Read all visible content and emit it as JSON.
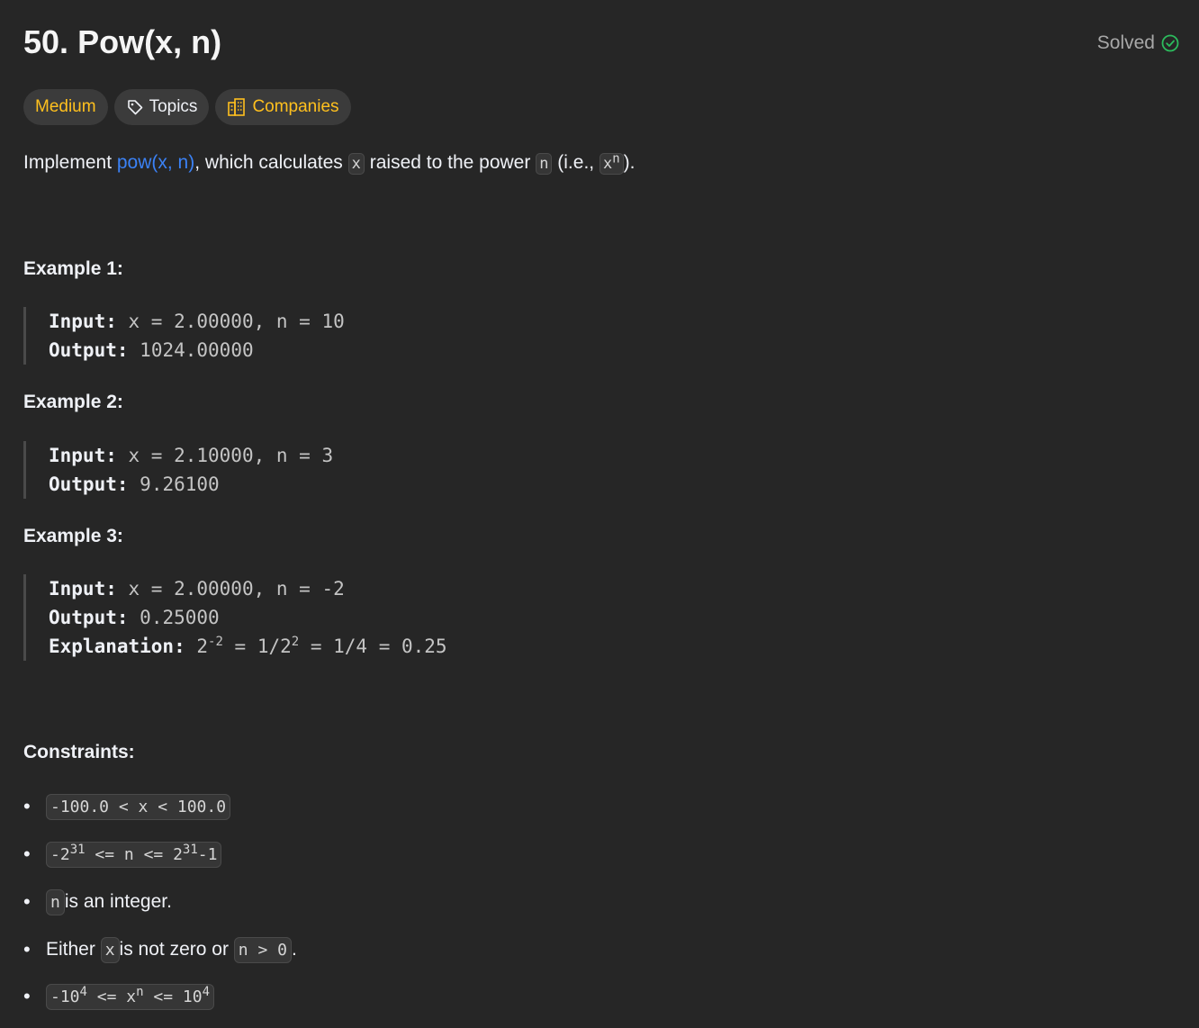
{
  "problem": {
    "number": "50.",
    "name": "Pow(x, n)",
    "status": "Solved"
  },
  "tags": {
    "difficulty": "Medium",
    "topics": "Topics",
    "companies": "Companies"
  },
  "description": {
    "prefix": "Implement ",
    "link": "pow(x, n)",
    "middle": ", which calculates ",
    "x": "x",
    "middle2": " raised to the power ",
    "n": "n",
    "middle3": " (i.e., ",
    "xn_base": "x",
    "xn_exp": "n",
    "suffix": ")."
  },
  "examples": [
    {
      "heading": "Example 1:",
      "input_label": "Input:",
      "input": "x = 2.00000, n = 10",
      "output_label": "Output:",
      "output": "1024.00000"
    },
    {
      "heading": "Example 2:",
      "input_label": "Input:",
      "input": "x = 2.10000, n = 3",
      "output_label": "Output:",
      "output": "9.26100"
    },
    {
      "heading": "Example 3:",
      "input_label": "Input:",
      "input": "x = 2.00000, n = -2",
      "output_label": "Output:",
      "output": "0.25000",
      "explanation_label": "Explanation:",
      "exp_base1": "2",
      "exp_pow1": "-2",
      "exp_mid": " = 1/2",
      "exp_pow2": "2",
      "exp_end": " = 1/4 = 0.25"
    }
  ],
  "constraints": {
    "heading": "Constraints:",
    "c1": "-100.0 < x < 100.0",
    "c2_a": "-2",
    "c2_a_exp": "31",
    "c2_b": " <= n <= 2",
    "c2_b_exp": "31",
    "c2_c": "-1",
    "c3_code": "n",
    "c3_text": " is an integer.",
    "c4_pre": "Either ",
    "c4_code1": "x",
    "c4_mid": " is not zero or ",
    "c4_code2": "n > 0",
    "c4_end": ".",
    "c5_a": "-10",
    "c5_a_exp": "4",
    "c5_b": " <= x",
    "c5_b_exp": "n",
    "c5_c": " <= 10",
    "c5_c_exp": "4"
  },
  "colors": {
    "background": "#262626",
    "medium": "#ffc01e",
    "link": "#3b82f6",
    "solved_check": "#2cbb5d"
  }
}
